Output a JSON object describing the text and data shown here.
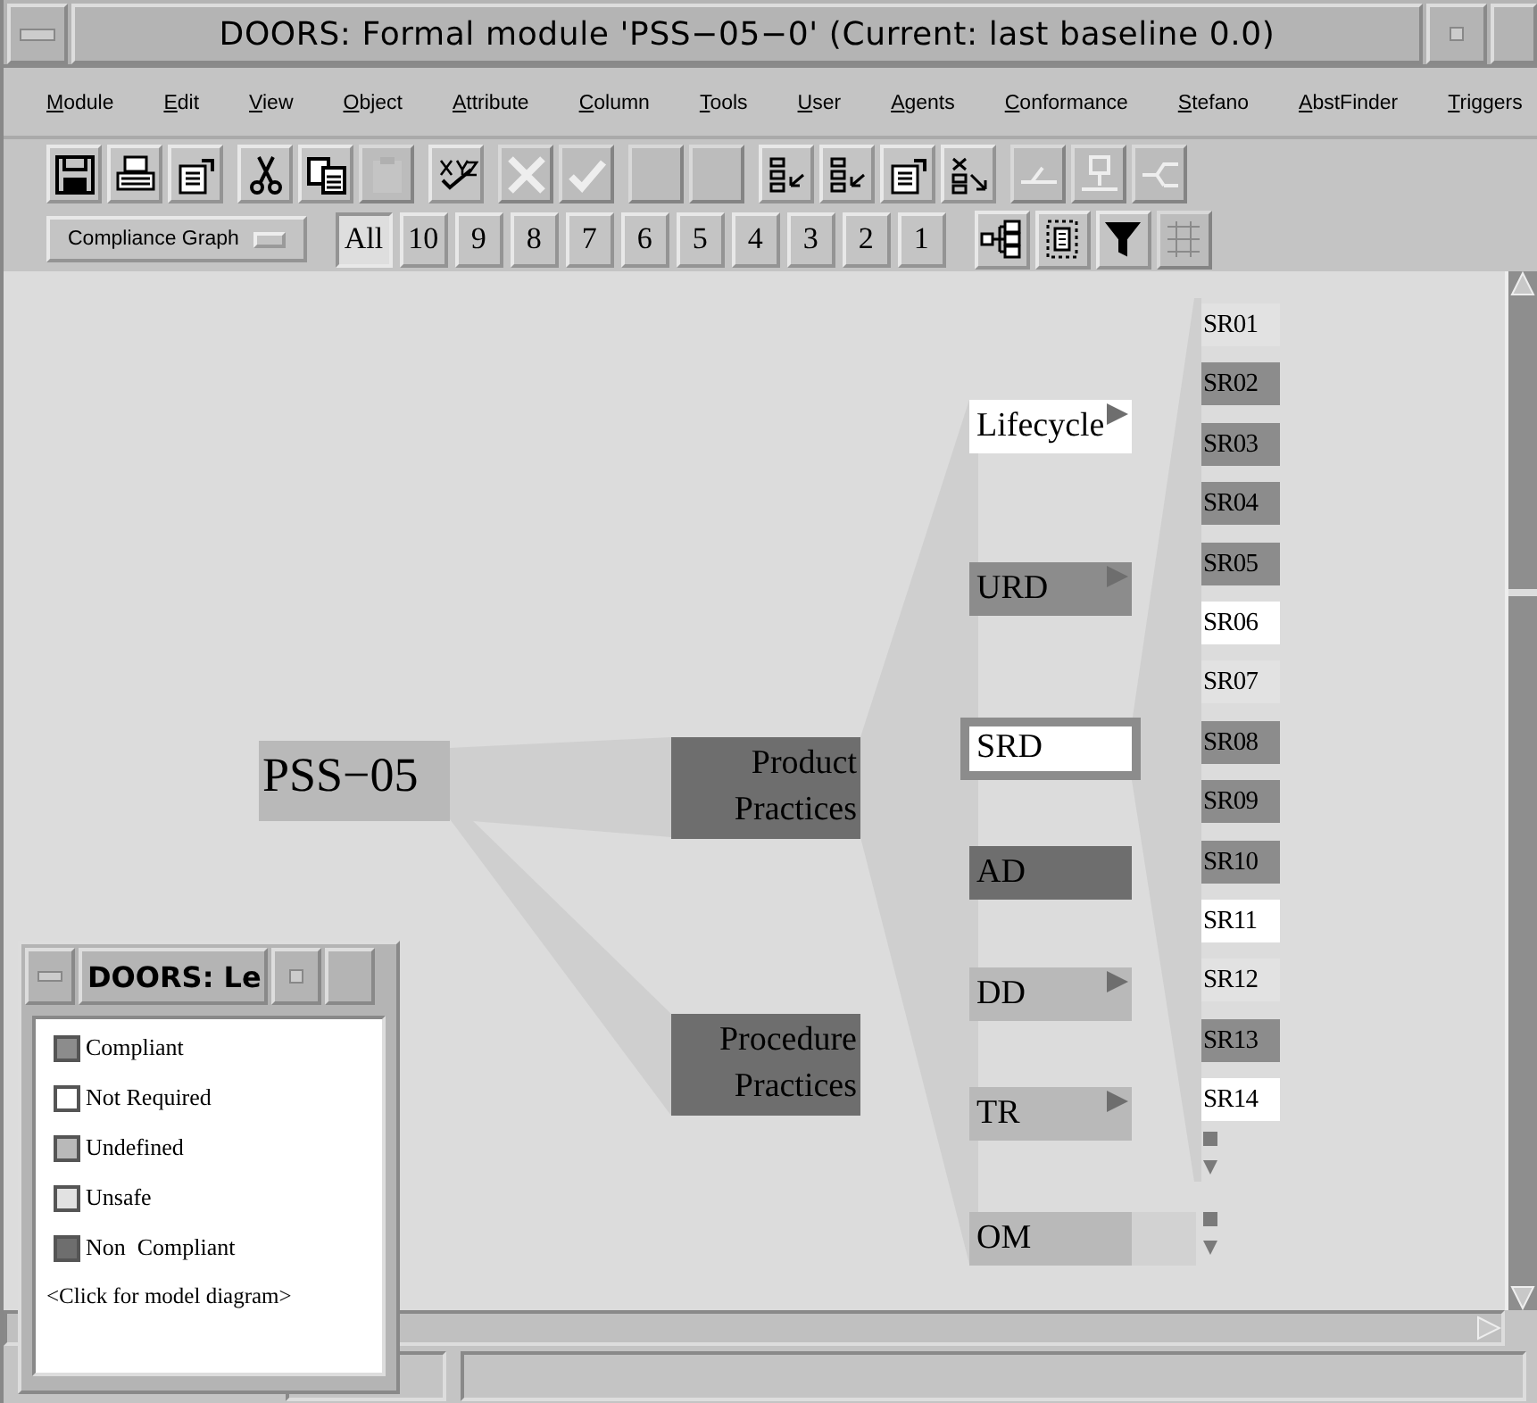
{
  "window": {
    "title": "DOORS: Formal module 'PSS−05−0' (Current: last baseline 0.0)"
  },
  "menu": [
    "Module",
    "Edit",
    "View",
    "Object",
    "Attribute",
    "Column",
    "Tools",
    "User",
    "Agents",
    "Conformance",
    "Stefano",
    "AbstFinder",
    "Triggers"
  ],
  "toolbar_groups": [
    [
      {
        "kind": "save",
        "disabled": false
      },
      {
        "kind": "print",
        "disabled": false
      },
      {
        "kind": "properties",
        "disabled": false
      }
    ],
    [
      {
        "kind": "cut",
        "disabled": false
      },
      {
        "kind": "copy",
        "disabled": false
      },
      {
        "kind": "paste",
        "disabled": true
      }
    ],
    [
      {
        "kind": "spell",
        "disabled": false
      }
    ],
    [
      {
        "kind": "cancel",
        "disabled": true
      },
      {
        "kind": "confirm",
        "disabled": true
      }
    ],
    [
      {
        "kind": "blank",
        "disabled": true
      },
      {
        "kind": "blank",
        "disabled": true
      }
    ],
    [
      {
        "kind": "list-in",
        "disabled": false
      },
      {
        "kind": "list-out",
        "disabled": false
      },
      {
        "kind": "properties",
        "disabled": false
      },
      {
        "kind": "list-delete",
        "disabled": false
      }
    ],
    [
      {
        "kind": "link-left",
        "disabled": true
      },
      {
        "kind": "link-up",
        "disabled": true
      },
      {
        "kind": "link-split",
        "disabled": true
      }
    ]
  ],
  "view_selector": "Compliance Graph",
  "levels": [
    {
      "label": "All",
      "selected": true
    },
    {
      "label": "10",
      "selected": false
    },
    {
      "label": "9",
      "selected": false
    },
    {
      "label": "8",
      "selected": false
    },
    {
      "label": "7",
      "selected": false
    },
    {
      "label": "6",
      "selected": false
    },
    {
      "label": "5",
      "selected": false
    },
    {
      "label": "4",
      "selected": false
    },
    {
      "label": "3",
      "selected": false
    },
    {
      "label": "2",
      "selected": false
    },
    {
      "label": "1",
      "selected": false
    }
  ],
  "view_tools": [
    {
      "kind": "tree",
      "disabled": false
    },
    {
      "kind": "document",
      "disabled": false
    },
    {
      "kind": "filter",
      "disabled": false
    },
    {
      "kind": "numbers",
      "disabled": true
    }
  ],
  "tree": {
    "label": "PSS−05",
    "color": "#b9b9b9",
    "children": [
      {
        "label": "Product Practices",
        "color": "#6e6e6e",
        "children": [
          {
            "label": "Lifecycle",
            "color": "#ffffff",
            "more": true,
            "selected": false
          },
          {
            "label": "URD",
            "color": "#8c8c8c",
            "more": true,
            "selected": false
          },
          {
            "label": "SRD",
            "color": "#ffffff",
            "more": false,
            "selected": true,
            "more_below": true,
            "children": [
              {
                "label": "SR01",
                "color": "#e2e2e2"
              },
              {
                "label": "SR02",
                "color": "#8c8c8c"
              },
              {
                "label": "SR03",
                "color": "#8c8c8c"
              },
              {
                "label": "SR04",
                "color": "#8c8c8c"
              },
              {
                "label": "SR05",
                "color": "#8c8c8c"
              },
              {
                "label": "SR06",
                "color": "#ffffff"
              },
              {
                "label": "SR07",
                "color": "#e2e2e2"
              },
              {
                "label": "SR08",
                "color": "#8c8c8c"
              },
              {
                "label": "SR09",
                "color": "#8c8c8c"
              },
              {
                "label": "SR10",
                "color": "#8c8c8c"
              },
              {
                "label": "SR11",
                "color": "#ffffff"
              },
              {
                "label": "SR12",
                "color": "#e2e2e2"
              },
              {
                "label": "SR13",
                "color": "#8c8c8c"
              },
              {
                "label": "SR14",
                "color": "#ffffff"
              }
            ]
          },
          {
            "label": "AD",
            "color": "#6e6e6e",
            "more": false,
            "selected": false
          },
          {
            "label": "DD",
            "color": "#b9b9b9",
            "more": true,
            "selected": false
          },
          {
            "label": "TR",
            "color": "#b9b9b9",
            "more": true,
            "selected": false
          },
          {
            "label": "OM",
            "color": "#b9b9b9",
            "more": false,
            "selected": false,
            "more_below": true
          }
        ]
      },
      {
        "label": "Procedure Practices",
        "color": "#6e6e6e"
      }
    ]
  },
  "legend": {
    "title": "DOORS: Le",
    "items": [
      {
        "label": "Compliant",
        "color": "#8c8c8c"
      },
      {
        "label": "Not Required",
        "color": "#ffffff"
      },
      {
        "label": "Undefined",
        "color": "#b9b9b9"
      },
      {
        "label": "Unsafe",
        "color": "#e2e2e2"
      },
      {
        "label": "Non  Compliant",
        "color": "#6e6e6e"
      }
    ],
    "link": "<Click for model diagram>"
  }
}
